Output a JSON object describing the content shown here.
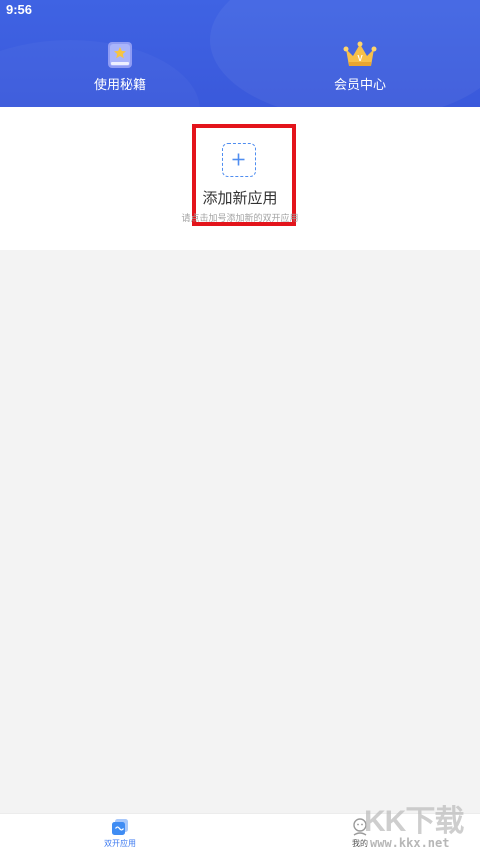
{
  "status_bar": {
    "time": "9:56"
  },
  "header": {
    "actions": [
      {
        "label": "使用秘籍",
        "icon": "secrets-book-icon"
      },
      {
        "label": "会员中心",
        "icon": "crown-icon"
      }
    ],
    "colors": {
      "background": "#3d5fe0",
      "text": "#ffffff"
    }
  },
  "add_app": {
    "icon": "plus-icon",
    "title": "添加新应用",
    "hint": "请点击加号添加新的双开应用",
    "highlight_color": "#e3141b",
    "accent_color": "#4f8df0"
  },
  "bottom_nav": {
    "items": [
      {
        "label": "双开应用",
        "icon": "dual-app-icon",
        "active": true
      },
      {
        "label": "我的",
        "icon": "profile-icon",
        "active": false
      }
    ],
    "active_color": "#3f7bf0"
  },
  "watermark": {
    "logo": "KK下载",
    "url": "www.kkx.net"
  }
}
